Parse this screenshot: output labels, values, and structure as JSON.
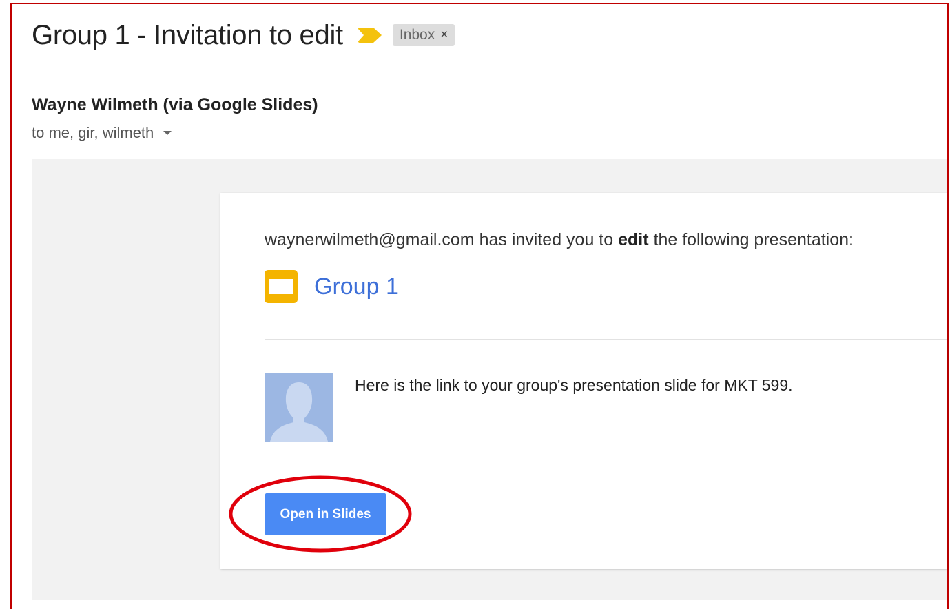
{
  "email": {
    "subject": "Group 1 - Invitation to edit",
    "label": "Inbox",
    "label_remove": "×",
    "sender": "Wayne Wilmeth (via Google Slides)",
    "recipients": "to me, gir, wilmeth"
  },
  "invite": {
    "inviter": "waynerwilmeth@gmail.com",
    "text_before": " has invited you to ",
    "permission": "edit",
    "text_after": " the following presentation:",
    "doc_title": "Group 1",
    "message": "Here is the link to your group's presentation slide for MKT 599.",
    "button_label": "Open in Slides"
  },
  "colors": {
    "importance_marker": "#f4c20d",
    "slides_icon": "#f4b400",
    "link": "#3d6fd8",
    "button": "#4a8af4",
    "highlight_ring": "#e0000b",
    "frame_border": "#c00000"
  },
  "icons": {
    "importance": "importance-marker-icon",
    "label_close": "close-icon",
    "recipients_toggle": "chevron-down-icon",
    "doc": "google-slides-icon",
    "avatar": "default-avatar-icon"
  }
}
